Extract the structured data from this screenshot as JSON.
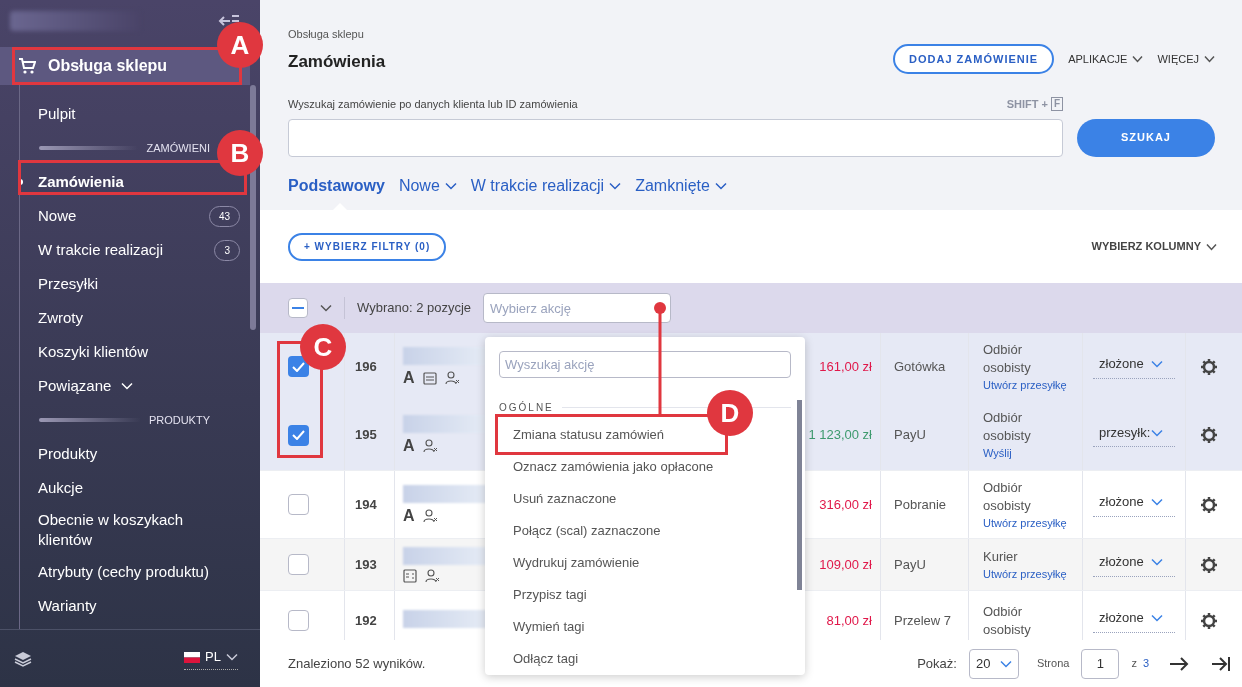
{
  "sidebar": {
    "section": {
      "label": "Obsługa sklepu",
      "selected": true
    },
    "items": [
      {
        "kind": "link",
        "label": "Pulpit",
        "selected": false
      },
      {
        "kind": "heading",
        "label": "ZAMÓWIENI"
      },
      {
        "kind": "link",
        "label": "Zamówienia",
        "selected": true
      },
      {
        "kind": "link",
        "label": "Nowe",
        "selected": false,
        "badge": "43"
      },
      {
        "kind": "link",
        "label": "W trakcie realizacji",
        "selected": false,
        "badge": "3"
      },
      {
        "kind": "link",
        "label": "Przesyłki",
        "selected": false
      },
      {
        "kind": "link",
        "label": "Zwroty",
        "selected": false
      },
      {
        "kind": "link",
        "label": "Koszyki klientów",
        "selected": false
      },
      {
        "kind": "dropdown",
        "label": "Powiązane",
        "selected": false
      },
      {
        "kind": "heading",
        "label": "PRODUKTY"
      },
      {
        "kind": "link",
        "label": "Produkty",
        "selected": false
      },
      {
        "kind": "link",
        "label": "Aukcje",
        "selected": false
      },
      {
        "kind": "link",
        "label": "Obecnie w koszykach klientów",
        "selected": false
      },
      {
        "kind": "link",
        "label": "Atrybuty (cechy produktu)",
        "selected": false
      },
      {
        "kind": "link",
        "label": "Warianty",
        "selected": false
      }
    ],
    "language": "PL"
  },
  "header": {
    "breadcrumb": "Obsługa sklepu",
    "title": "Zamówienia",
    "add_button": "DODAJ ZAMÓWIENIE",
    "menus": [
      "APLIKACJE",
      "WIĘCEJ"
    ]
  },
  "search": {
    "label": "Wyszukaj zamówienie po danych klienta lub ID zamówienia",
    "shortcut": "SHIFT +",
    "shortcut_key": "F",
    "button": "SZUKAJ"
  },
  "tabs": [
    {
      "label": "Podstawowy",
      "selected": true,
      "dropdown": false
    },
    {
      "label": "Nowe",
      "selected": false,
      "dropdown": true
    },
    {
      "label": "W trakcie realizacji",
      "selected": false,
      "dropdown": true
    },
    {
      "label": "Zamknięte",
      "selected": false,
      "dropdown": true
    }
  ],
  "filters_button": "+ WYBIERZ FILTRY (0)",
  "columns_button": "WYBIERZ KOLUMNY",
  "bulk_bar": {
    "select_all_partial": true,
    "selection": "Wybrano: 2 pozycje",
    "action_placeholder": "Wybierz akcję"
  },
  "rows": [
    {
      "id": "196",
      "checked": true,
      "letter": "A",
      "note": true,
      "invoice": false,
      "user_flag": true,
      "amount": "161,00 zł",
      "paid": false,
      "payment": "Gotówka",
      "shipping": "Odbiór osobisty",
      "shipping_link": "Utwórz przesyłkę",
      "status": "złożone"
    },
    {
      "id": "195",
      "checked": true,
      "letter": "A",
      "note": false,
      "invoice": false,
      "user_flag": true,
      "amount": "1 123,00 zł",
      "paid": true,
      "payment": "PayU",
      "shipping": "Odbiór osobisty",
      "shipping_link": "Wyślij",
      "status": "przesyłk:"
    },
    {
      "id": "194",
      "checked": false,
      "letter": "A",
      "note": false,
      "invoice": false,
      "user_flag": true,
      "amount": "316,00 zł",
      "paid": false,
      "payment": "Pobranie",
      "shipping": "Odbiór osobisty",
      "shipping_link": "Utwórz przesyłkę",
      "status": "złożone"
    },
    {
      "id": "193",
      "checked": false,
      "note": false,
      "invoice": true,
      "user_flag": true,
      "amount": "109,00 zł",
      "paid": false,
      "payment": "PayU",
      "shipping": "Kurier",
      "shipping_link": "Utwórz przesyłkę",
      "status": "złożone"
    },
    {
      "id": "192",
      "checked": false,
      "note": false,
      "invoice": false,
      "user_flag": false,
      "amount": "81,00 zł",
      "paid": false,
      "payment": "Przelew 7",
      "shipping": "Odbiór osobisty",
      "status": "złożone"
    }
  ],
  "action_menu": {
    "search_placeholder": "Wyszukaj akcję",
    "group": "OGÓLNE",
    "actions": [
      "Zmiana statusu zamówień",
      "Oznacz zamówienia jako opłacone",
      "Usuń zaznaczone",
      "Połącz (scal) zaznaczone",
      "Wydrukuj zamówienie",
      "Przypisz tagi",
      "Wymień tagi",
      "Odłącz tagi"
    ]
  },
  "footer": {
    "results": "Znaleziono 52 wyników.",
    "show_label": "Pokaż:",
    "page_size": "20",
    "page_label": "Strona",
    "page": "1",
    "of": "z",
    "pages": "3"
  },
  "annotations": [
    "A",
    "B",
    "C",
    "D"
  ]
}
